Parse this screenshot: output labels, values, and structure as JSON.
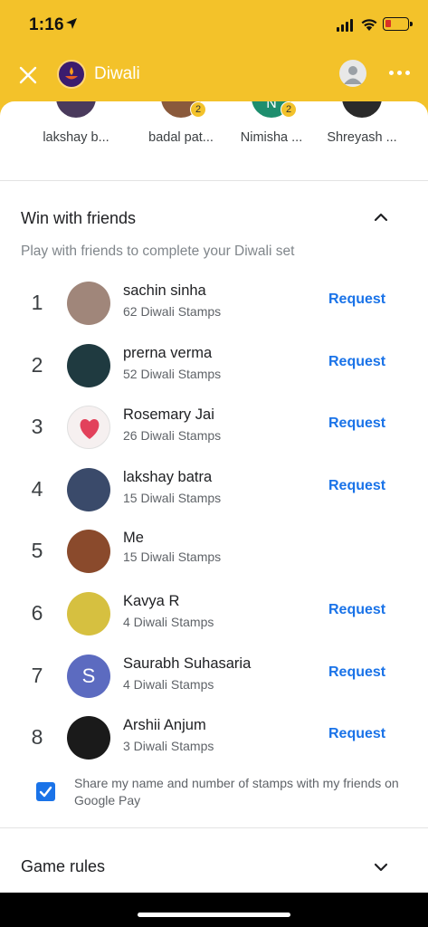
{
  "status_bar": {
    "time": "1:16"
  },
  "app_bar": {
    "title": "Diwali"
  },
  "friend_strip": [
    {
      "name": "lakshay b...",
      "badge": "",
      "avatar_color": "#4a3a5c"
    },
    {
      "name": "badal pat...",
      "badge": "2",
      "avatar_color": "#8a5a3c"
    },
    {
      "name": "Nimisha ...",
      "badge": "2",
      "avatar_color": "#1e8e6e",
      "initial": "N"
    },
    {
      "name": "Shreyash ...",
      "badge": "",
      "avatar_color": "#2a2a2a"
    }
  ],
  "win_section": {
    "title": "Win with friends",
    "subtitle": "Play with friends to complete your Diwali set",
    "request_label": "Request",
    "leaderboard": [
      {
        "rank": "1",
        "name": "sachin sinha",
        "stamps": "62 Diwali Stamps",
        "has_request": true,
        "avatar_color": "#a0867a"
      },
      {
        "rank": "2",
        "name": "prerna verma",
        "stamps": "52 Diwali Stamps",
        "has_request": true,
        "avatar_color": "#1f3a40"
      },
      {
        "rank": "3",
        "name": "Rosemary Jai",
        "stamps": "26 Diwali Stamps",
        "has_request": true,
        "avatar_color": "#f6f0f0"
      },
      {
        "rank": "4",
        "name": "lakshay batra",
        "stamps": "15 Diwali Stamps",
        "has_request": true,
        "avatar_color": "#3a4a6a"
      },
      {
        "rank": "5",
        "name": "Me",
        "stamps": "15 Diwali Stamps",
        "has_request": false,
        "avatar_color": "#8a4a2c"
      },
      {
        "rank": "6",
        "name": "Kavya R",
        "stamps": "4 Diwali Stamps",
        "has_request": true,
        "avatar_color": "#d6c040"
      },
      {
        "rank": "7",
        "name": "Saurabh Suhasaria",
        "stamps": "4 Diwali Stamps",
        "has_request": true,
        "avatar_color": "#5c6bc0",
        "initial": "S"
      },
      {
        "rank": "8",
        "name": "Arshii Anjum",
        "stamps": "3 Diwali Stamps",
        "has_request": true,
        "avatar_color": "#1a1a1a"
      }
    ]
  },
  "share": {
    "checked": true,
    "text": "Share my name and number of stamps with my friends on Google Pay"
  },
  "game_rules": {
    "title": "Game rules"
  },
  "colors": {
    "accent": "#1a73e8",
    "header": "#F3C22A",
    "badge": "#F3C22A"
  }
}
